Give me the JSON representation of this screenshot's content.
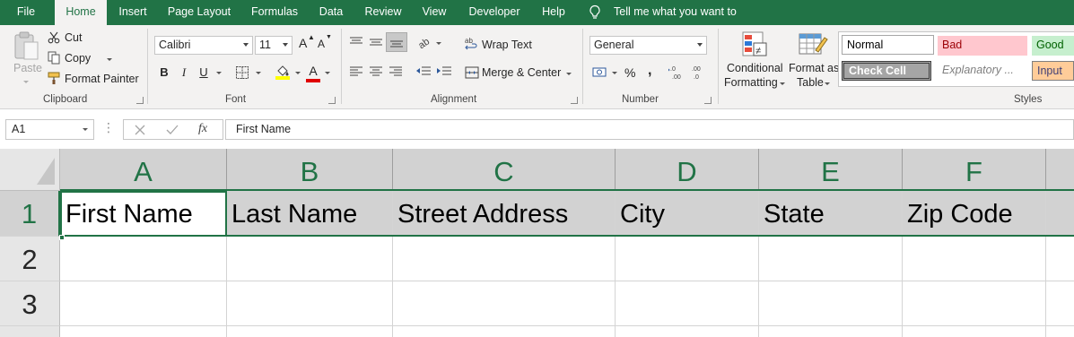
{
  "menu": {
    "tabs": [
      "File",
      "Home",
      "Insert",
      "Page Layout",
      "Formulas",
      "Data",
      "Review",
      "View",
      "Developer",
      "Help"
    ],
    "active_tab": "Home",
    "tell_me": "Tell me what you want to do"
  },
  "ribbon": {
    "clipboard": {
      "paste": "Paste",
      "cut": "Cut",
      "copy": "Copy",
      "format_painter": "Format Painter",
      "label": "Clipboard"
    },
    "font": {
      "name": "Calibri",
      "size": "11",
      "label": "Font",
      "bold": "B",
      "italic": "I",
      "underline": "U",
      "grow": "A",
      "shrink": "A"
    },
    "alignment": {
      "wrap_text": "Wrap Text",
      "merge_center": "Merge & Center",
      "label": "Alignment"
    },
    "number": {
      "format": "General",
      "percent": "%",
      "comma": ",",
      "label": "Number"
    },
    "styles": {
      "conditional_formatting": [
        "Conditional",
        "Formatting"
      ],
      "format_as_table": [
        "Format as",
        "Table"
      ],
      "cells": [
        "Normal",
        "Bad",
        "Good",
        "Check Cell",
        "Explanatory ...",
        "Input"
      ],
      "label": "Styles"
    }
  },
  "formula_bar": {
    "name_box": "A1",
    "fx": "fx",
    "value": "First Name"
  },
  "sheet": {
    "columns": [
      "A",
      "B",
      "C",
      "D",
      "E",
      "F"
    ],
    "rows": [
      "1",
      "2",
      "3"
    ],
    "row1": [
      "First Name",
      "Last Name",
      "Street Address",
      "City",
      "State",
      "Zip Code"
    ],
    "active_cell": "A1"
  },
  "colors": {
    "accent": "#217346",
    "ribbon_bg": "#f3f2f1",
    "header_selected": "#d2d2d2",
    "bad": "#ffc7ce",
    "good": "#c6efce",
    "input": "#ffcc99",
    "check_cell": "#a5a5a5"
  }
}
